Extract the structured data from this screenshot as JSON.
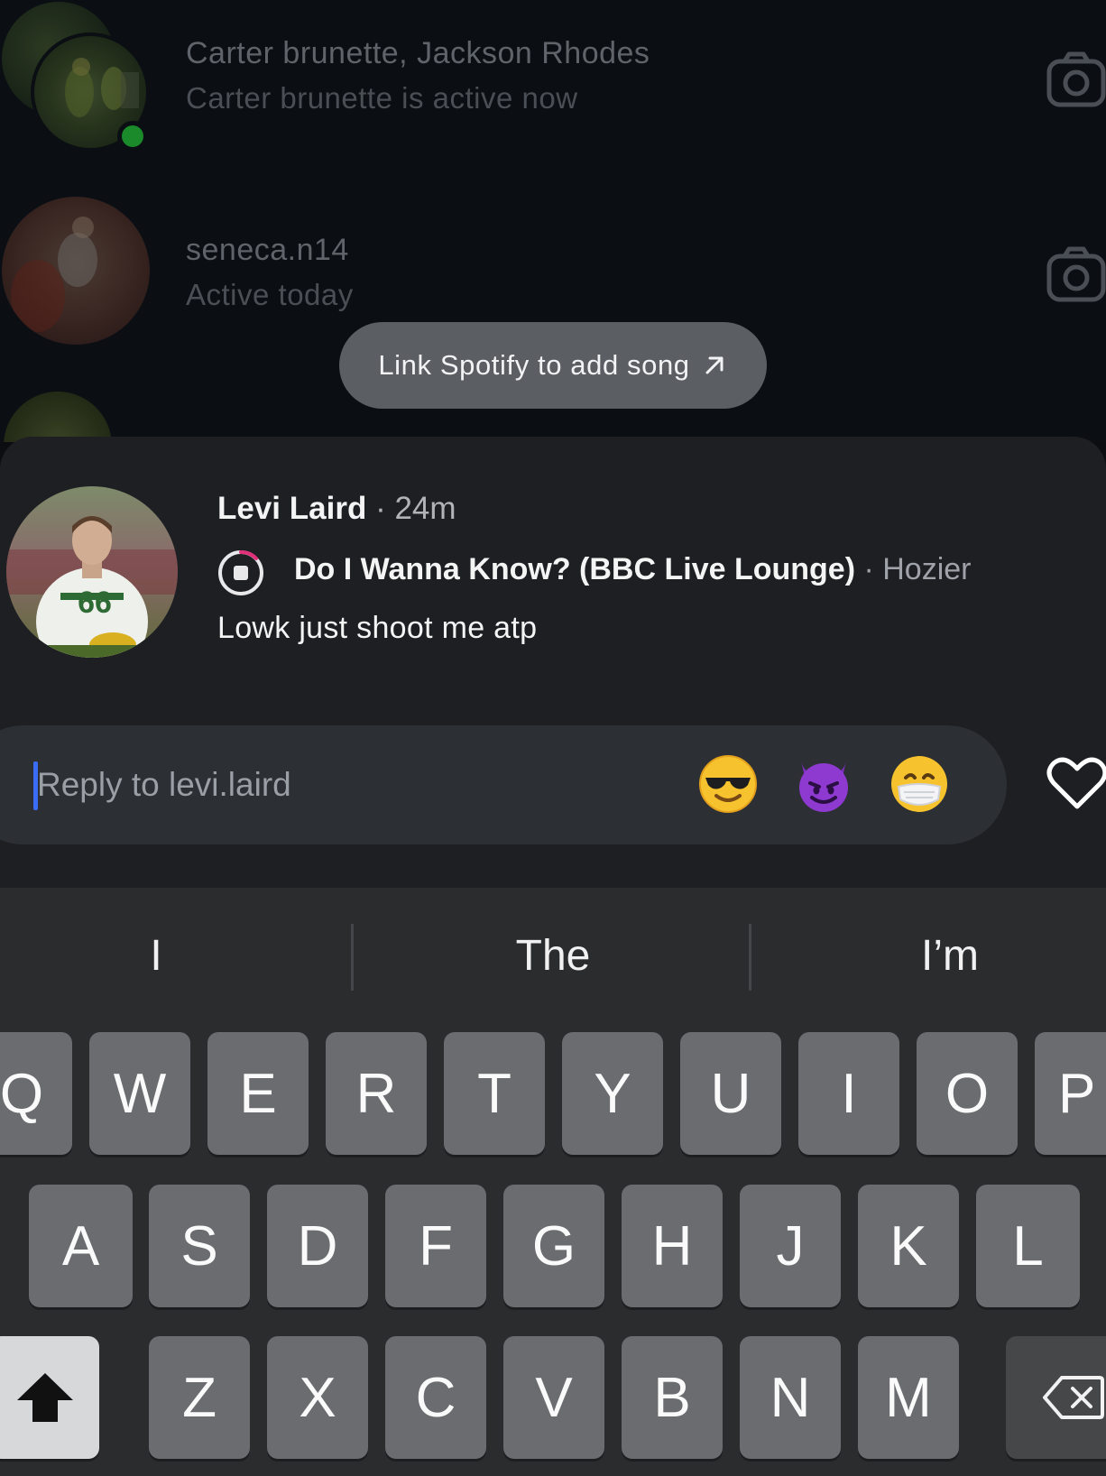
{
  "chat_list": {
    "rows": [
      {
        "name": "Carter brunette, Jackson Rhodes",
        "status": "Carter brunette is active now"
      },
      {
        "name": "seneca.n14",
        "status": "Active today"
      }
    ]
  },
  "spotify_prompt": {
    "label": "Link Spotify to add song"
  },
  "note": {
    "author": "Levi Laird",
    "time": "· 24m",
    "song_title": "Do I Wanna Know? (BBC Live Lounge)",
    "song_artist": "· Hozier",
    "text": "Lowk just shoot me atp"
  },
  "reply": {
    "placeholder": "Reply to levi.laird",
    "quick_emojis": [
      "smiling-face-with-sunglasses",
      "smiling-face-with-horns",
      "face-with-medical-mask"
    ]
  },
  "keyboard": {
    "suggestions": [
      "I",
      "The",
      "I’m"
    ],
    "row1": [
      "Q",
      "W",
      "E",
      "R",
      "T",
      "Y",
      "U",
      "I",
      "O",
      "P"
    ],
    "row2": [
      "A",
      "S",
      "D",
      "F",
      "G",
      "H",
      "J",
      "K",
      "L"
    ],
    "row3": [
      "Z",
      "X",
      "C",
      "V",
      "B",
      "N",
      "M"
    ],
    "shift_icon": "shift-arrow-icon",
    "delete_icon": "backspace-icon"
  },
  "colors": {
    "background": "#0b0e12",
    "sheet": "#1d1f23",
    "reply_bar": "#2c2f34",
    "caret": "#3b6cf6",
    "key": "#6a6c6f",
    "keyboard": "#2b2c2e",
    "online": "#1a8a2a"
  }
}
